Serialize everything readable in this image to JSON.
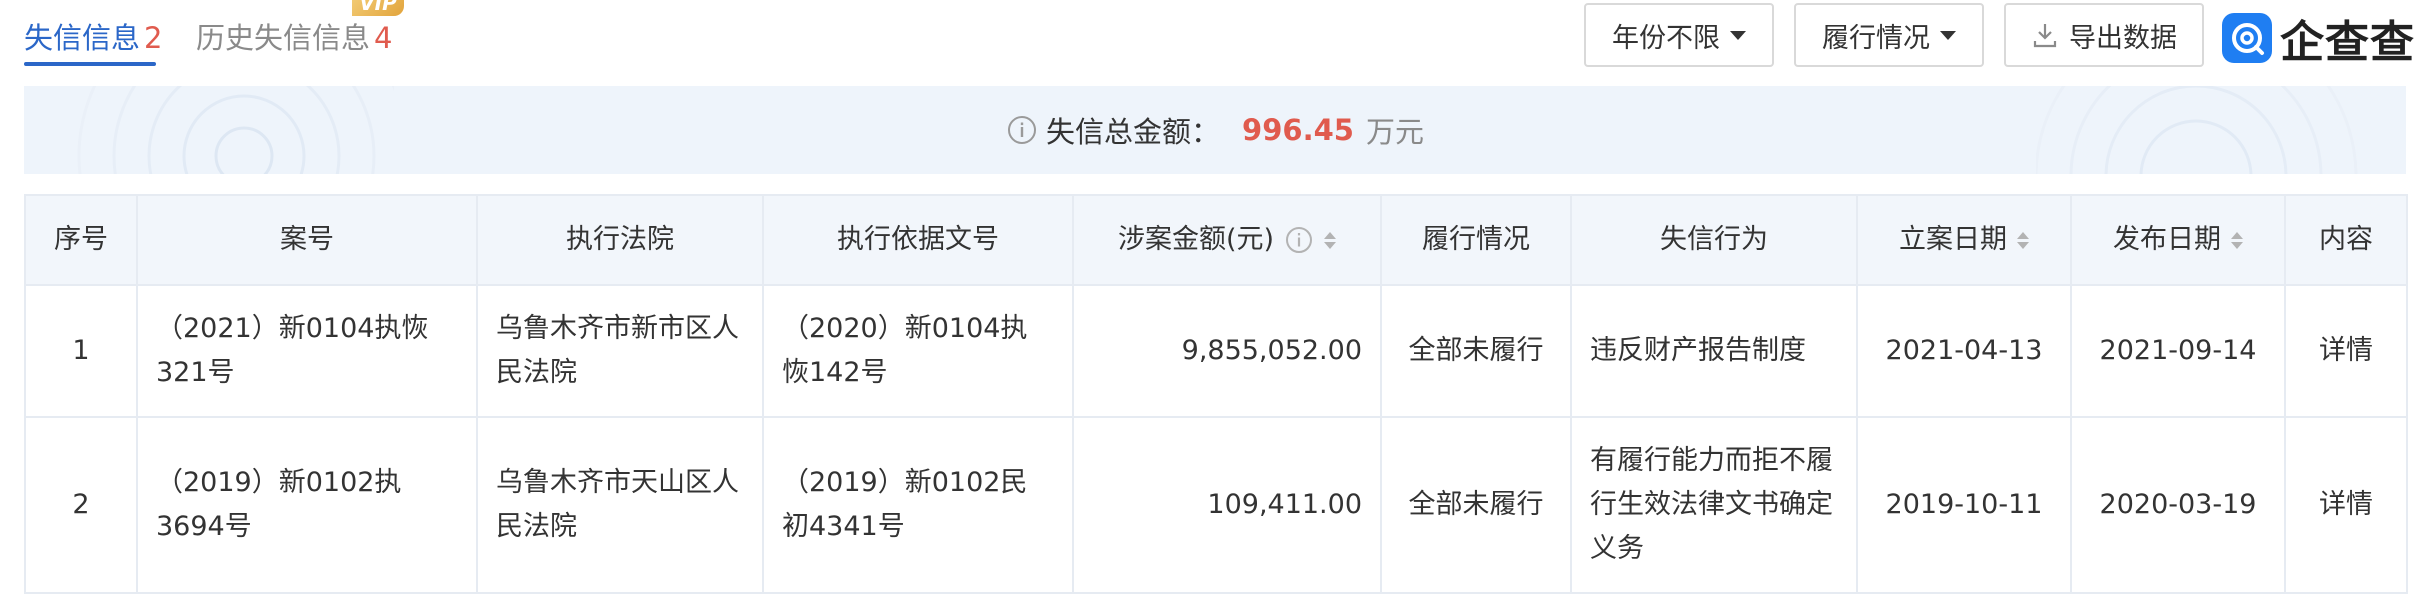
{
  "tabs": {
    "active": {
      "label": "失信信息",
      "count": "2"
    },
    "history": {
      "label": "历史失信信息",
      "count": "4",
      "badge": "VIP"
    }
  },
  "filters": {
    "year": {
      "label": "年份不限",
      "icon": "caret-down-icon"
    },
    "performance": {
      "label": "履行情况",
      "icon": "caret-down-icon"
    },
    "export": {
      "label": "导出数据",
      "icon": "download-icon"
    }
  },
  "brand": {
    "name": "企查查",
    "color": "#1f7ef2"
  },
  "summary": {
    "label": "失信总金额：",
    "amount": "996.45",
    "unit": "万元",
    "icon": "info-icon"
  },
  "table": {
    "headers": {
      "index": "序号",
      "case_no": "案号",
      "court": "执行法院",
      "basis_no": "执行依据文号",
      "amount": "涉案金额(元)",
      "performance": "履行情况",
      "behavior": "失信行为",
      "filing_date": "立案日期",
      "publish_date": "发布日期",
      "content": "内容"
    },
    "rows": [
      {
        "index": "1",
        "case_no": "（2021）新0104执恢321号",
        "court": "乌鲁木齐市新市区人民法院",
        "basis_no": "（2020）新0104执恢142号",
        "amount": "9,855,052.00",
        "performance": "全部未履行",
        "behavior": "违反财产报告制度",
        "filing_date": "2021-04-13",
        "publish_date": "2021-09-14",
        "content": "详情"
      },
      {
        "index": "2",
        "case_no": "（2019）新0102执3694号",
        "court": "乌鲁木齐市天山区人民法院",
        "basis_no": "（2019）新0102民初4341号",
        "amount": "109,411.00",
        "performance": "全部未履行",
        "behavior": "有履行能力而拒不履行生效法律文书确定义务",
        "filing_date": "2019-10-11",
        "publish_date": "2020-03-19",
        "content": "详情"
      }
    ]
  },
  "colors": {
    "link": "#2b67c8",
    "accent_red": "#e05b4e",
    "header_bg": "#f2f6fb",
    "banner_bg": "#eef4fb"
  }
}
